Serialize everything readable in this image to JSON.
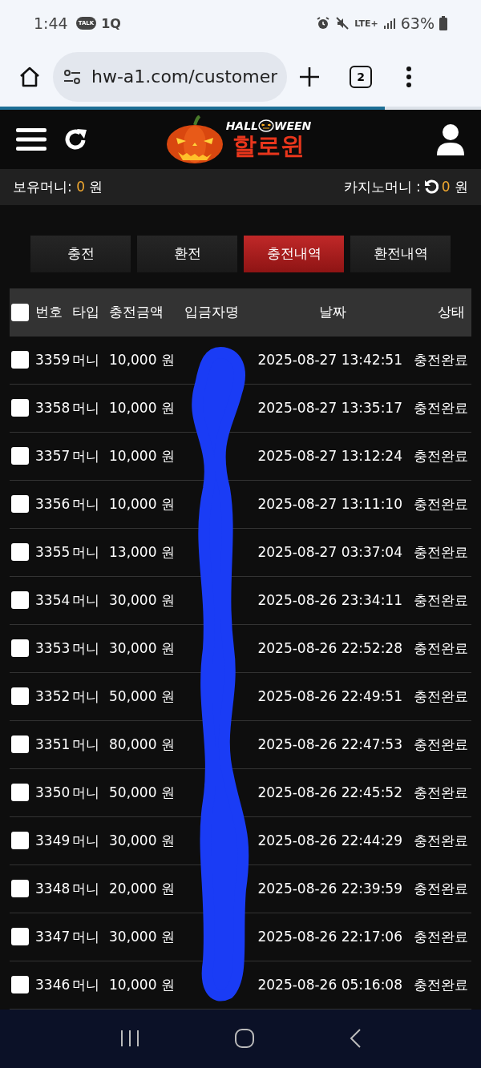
{
  "status_bar": {
    "time": "1:44",
    "talk_badge": "TALK",
    "app_badge": "1Q",
    "network": "LTE+",
    "battery": "63%"
  },
  "browser": {
    "url": "hw-a1.com/customer",
    "tab_count": "2",
    "progress": {
      "level": 0.8
    }
  },
  "header": {
    "logo_top_left": "HALL",
    "logo_top_right": "WEEN",
    "logo_main": "할로윈"
  },
  "balance": {
    "label": "보유머니:",
    "amount": "0",
    "unit": "원",
    "casino_label": "카지노머니 :",
    "casino_amount": "0",
    "casino_unit": "원"
  },
  "tabs": [
    {
      "label": "충전",
      "selected": false
    },
    {
      "label": "환전",
      "selected": false
    },
    {
      "label": "충전내역",
      "selected": true
    },
    {
      "label": "환전내역",
      "selected": false
    }
  ],
  "table": {
    "all_checked": false,
    "columns": [
      "번호",
      "타입",
      "충전금액",
      "입금자명",
      "날짜",
      "상태"
    ],
    "rows": [
      {
        "checked": false,
        "number": "3359",
        "type": "머니",
        "amount": "10,000 원",
        "date": "2025-08-27 13:42:51",
        "status": "충전완료"
      },
      {
        "checked": false,
        "number": "3358",
        "type": "머니",
        "amount": "10,000 원",
        "date": "2025-08-27 13:35:17",
        "status": "충전완료"
      },
      {
        "checked": false,
        "number": "3357",
        "type": "머니",
        "amount": "10,000 원",
        "date": "2025-08-27 13:12:24",
        "status": "충전완료"
      },
      {
        "checked": false,
        "number": "3356",
        "type": "머니",
        "amount": "10,000 원",
        "date": "2025-08-27 13:11:10",
        "status": "충전완료"
      },
      {
        "checked": false,
        "number": "3355",
        "type": "머니",
        "amount": "13,000 원",
        "date": "2025-08-27 03:37:04",
        "status": "충전완료"
      },
      {
        "checked": false,
        "number": "3354",
        "type": "머니",
        "amount": "30,000 원",
        "date": "2025-08-26 23:34:11",
        "status": "충전완료"
      },
      {
        "checked": false,
        "number": "3353",
        "type": "머니",
        "amount": "30,000 원",
        "date": "2025-08-26 22:52:28",
        "status": "충전완료"
      },
      {
        "checked": false,
        "number": "3352",
        "type": "머니",
        "amount": "50,000 원",
        "date": "2025-08-26 22:49:51",
        "status": "충전완료"
      },
      {
        "checked": false,
        "number": "3351",
        "type": "머니",
        "amount": "80,000 원",
        "date": "2025-08-26 22:47:53",
        "status": "충전완료"
      },
      {
        "checked": false,
        "number": "3350",
        "type": "머니",
        "amount": "50,000 원",
        "date": "2025-08-26 22:45:52",
        "status": "충전완료"
      },
      {
        "checked": false,
        "number": "3349",
        "type": "머니",
        "amount": "30,000 원",
        "date": "2025-08-26 22:44:29",
        "status": "충전완료"
      },
      {
        "checked": false,
        "number": "3348",
        "type": "머니",
        "amount": "20,000 원",
        "date": "2025-08-26 22:39:59",
        "status": "충전완료"
      },
      {
        "checked": false,
        "number": "3347",
        "type": "머니",
        "amount": "30,000 원",
        "date": "2025-08-26 22:17:06",
        "status": "충전완료"
      },
      {
        "checked": false,
        "number": "3346",
        "type": "머니",
        "amount": "10,000 원",
        "date": "2025-08-26 05:16:08",
        "status": "충전완료"
      }
    ]
  }
}
